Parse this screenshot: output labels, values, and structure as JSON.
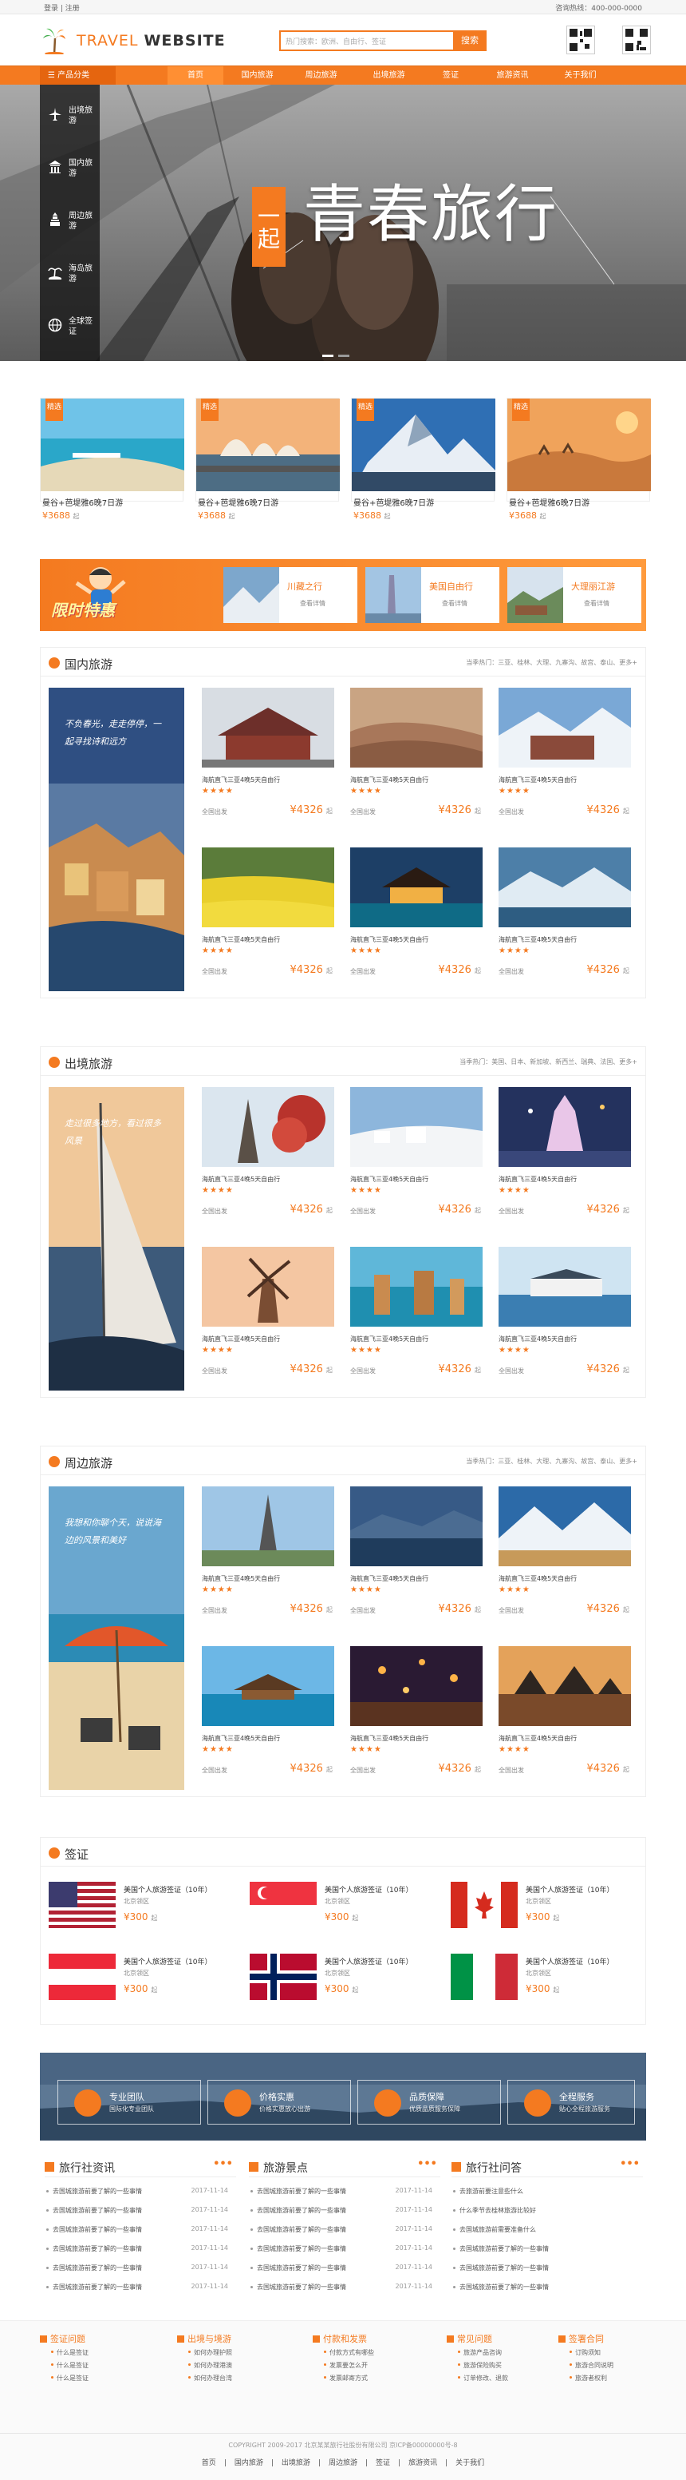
{
  "topbar": {
    "left": "登录 | 注册",
    "right": "咨询热线：400-000-0000"
  },
  "header": {
    "logo_light": "TRAVEL",
    "logo_bold": "WEBSITE",
    "search_placeholder": "热门搜索：欧洲、自由行、签证",
    "search_button": "搜索"
  },
  "nav": {
    "category": "产品分类",
    "items": [
      "首页",
      "国内旅游",
      "周边旅游",
      "出境旅游",
      "签证",
      "旅游资讯",
      "关于我们"
    ]
  },
  "banner": {
    "side": [
      {
        "label": "出境旅游",
        "icon": "plane-icon"
      },
      {
        "label": "国内旅游",
        "icon": "temple-icon"
      },
      {
        "label": "周边旅游",
        "icon": "tower-icon"
      },
      {
        "label": "海岛旅游",
        "icon": "island-icon"
      },
      {
        "label": "全球签证",
        "icon": "visa-icon"
      }
    ],
    "slogan_small": "一起",
    "slogan_big": "青春旅行"
  },
  "promos": [
    {
      "tag": "精选",
      "title": "曼谷+芭堤雅6晚7日游",
      "price": "¥3688",
      "unit": "起"
    },
    {
      "tag": "精选",
      "title": "曼谷+芭堤雅6晚7日游",
      "price": "¥3688",
      "unit": "起"
    },
    {
      "tag": "精选",
      "title": "曼谷+芭堤雅6晚7日游",
      "price": "¥3688",
      "unit": "起"
    },
    {
      "tag": "精选",
      "title": "曼谷+芭堤雅6晚7日游",
      "price": "¥3688",
      "unit": "起"
    }
  ],
  "specials": {
    "title": "限时特惠",
    "items": [
      {
        "title": "川藏之行",
        "link": "查看详情"
      },
      {
        "title": "美国自由行",
        "link": "查看详情"
      },
      {
        "title": "大理丽江游",
        "link": "查看详情"
      }
    ]
  },
  "sections": [
    {
      "title": "国内旅游",
      "hot": "当季热门：三亚、桂林、大理、九寨沟、故宫、泰山、更多+",
      "poster_text": "不负春光，走走停停，一起寻找诗和远方",
      "cards": [
        {
          "title": "海航直飞三亚4晚5天自由行",
          "stars": "★★★★",
          "sub": "全国出发",
          "price": "¥4326",
          "unit": "起"
        },
        {
          "title": "海航直飞三亚4晚5天自由行",
          "stars": "★★★★",
          "sub": "全国出发",
          "price": "¥4326",
          "unit": "起"
        },
        {
          "title": "海航直飞三亚4晚5天自由行",
          "stars": "★★★★",
          "sub": "全国出发",
          "price": "¥4326",
          "unit": "起"
        },
        {
          "title": "海航直飞三亚4晚5天自由行",
          "stars": "★★★★",
          "sub": "全国出发",
          "price": "¥4326",
          "unit": "起"
        },
        {
          "title": "海航直飞三亚4晚5天自由行",
          "stars": "★★★★",
          "sub": "全国出发",
          "price": "¥4326",
          "unit": "起"
        },
        {
          "title": "海航直飞三亚4晚5天自由行",
          "stars": "★★★★",
          "sub": "全国出发",
          "price": "¥4326",
          "unit": "起"
        }
      ]
    },
    {
      "title": "出境旅游",
      "hot": "当季热门：美国、日本、新加坡、新西兰、瑞典、法国、更多+",
      "poster_text": "走过很多地方，看过很多风景",
      "cards": [
        {
          "title": "海航直飞三亚4晚5天自由行",
          "stars": "★★★★",
          "sub": "全国出发",
          "price": "¥4326",
          "unit": "起"
        },
        {
          "title": "海航直飞三亚4晚5天自由行",
          "stars": "★★★★",
          "sub": "全国出发",
          "price": "¥4326",
          "unit": "起"
        },
        {
          "title": "海航直飞三亚4晚5天自由行",
          "stars": "★★★★",
          "sub": "全国出发",
          "price": "¥4326",
          "unit": "起"
        },
        {
          "title": "海航直飞三亚4晚5天自由行",
          "stars": "★★★★",
          "sub": "全国出发",
          "price": "¥4326",
          "unit": "起"
        },
        {
          "title": "海航直飞三亚4晚5天自由行",
          "stars": "★★★★",
          "sub": "全国出发",
          "price": "¥4326",
          "unit": "起"
        },
        {
          "title": "海航直飞三亚4晚5天自由行",
          "stars": "★★★★",
          "sub": "全国出发",
          "price": "¥4326",
          "unit": "起"
        }
      ]
    },
    {
      "title": "周边旅游",
      "hot": "当季热门：三亚、桂林、大理、九寨沟、故宫、泰山、更多+",
      "poster_text": "我想和你聊个天，说说海边的风景和美好",
      "cards": [
        {
          "title": "海航直飞三亚4晚5天自由行",
          "stars": "★★★★",
          "sub": "全国出发",
          "price": "¥4326",
          "unit": "起"
        },
        {
          "title": "海航直飞三亚4晚5天自由行",
          "stars": "★★★★",
          "sub": "全国出发",
          "price": "¥4326",
          "unit": "起"
        },
        {
          "title": "海航直飞三亚4晚5天自由行",
          "stars": "★★★★",
          "sub": "全国出发",
          "price": "¥4326",
          "unit": "起"
        },
        {
          "title": "海航直飞三亚4晚5天自由行",
          "stars": "★★★★",
          "sub": "全国出发",
          "price": "¥4326",
          "unit": "起"
        },
        {
          "title": "海航直飞三亚4晚5天自由行",
          "stars": "★★★★",
          "sub": "全国出发",
          "price": "¥4326",
          "unit": "起"
        },
        {
          "title": "海航直飞三亚4晚5天自由行",
          "stars": "★★★★",
          "sub": "全国出发",
          "price": "¥4326",
          "unit": "起"
        }
      ]
    }
  ],
  "visa": {
    "title": "签证",
    "items": [
      {
        "country": "usa",
        "title": "美国个人旅游签证（10年）",
        "sub": "北京领区",
        "price": "¥300",
        "unit": "起"
      },
      {
        "country": "singapore",
        "title": "美国个人旅游签证（10年）",
        "sub": "北京领区",
        "price": "¥300",
        "unit": "起"
      },
      {
        "country": "canada",
        "title": "美国个人旅游签证（10年）",
        "sub": "北京领区",
        "price": "¥300",
        "unit": "起"
      },
      {
        "country": "austria",
        "title": "美国个人旅游签证（10年）",
        "sub": "北京领区",
        "price": "¥300",
        "unit": "起"
      },
      {
        "country": "norway",
        "title": "美国个人旅游签证（10年）",
        "sub": "北京领区",
        "price": "¥300",
        "unit": "起"
      },
      {
        "country": "italy",
        "title": "美国个人旅游签证（10年）",
        "sub": "北京领区",
        "price": "¥300",
        "unit": "起"
      }
    ]
  },
  "features": [
    {
      "a": "专业团队",
      "b": "国际化专业团队",
      "icon": "location-icon"
    },
    {
      "a": "价格实惠",
      "b": "价格实惠放心出游",
      "icon": "yen-icon"
    },
    {
      "a": "品质保障",
      "b": "优质品质服务保障",
      "icon": "diamond-icon"
    },
    {
      "a": "全程服务",
      "b": "贴心全程旅游服务",
      "icon": "service-icon"
    }
  ],
  "news": [
    {
      "title": "旅行社资讯",
      "more": "•••",
      "rows": [
        {
          "t": "去国城旅游前要了解的一些事情",
          "d": "2017-11-14"
        },
        {
          "t": "去国城旅游前要了解的一些事情",
          "d": "2017-11-14"
        },
        {
          "t": "去国城旅游前要了解的一些事情",
          "d": "2017-11-14"
        },
        {
          "t": "去国城旅游前要了解的一些事情",
          "d": "2017-11-14"
        },
        {
          "t": "去国城旅游前要了解的一些事情",
          "d": "2017-11-14"
        },
        {
          "t": "去国城旅游前要了解的一些事情",
          "d": "2017-11-14"
        }
      ]
    },
    {
      "title": "旅游景点",
      "more": "•••",
      "rows": [
        {
          "t": "去国城旅游前要了解的一些事情",
          "d": "2017-11-14"
        },
        {
          "t": "去国城旅游前要了解的一些事情",
          "d": "2017-11-14"
        },
        {
          "t": "去国城旅游前要了解的一些事情",
          "d": "2017-11-14"
        },
        {
          "t": "去国城旅游前要了解的一些事情",
          "d": "2017-11-14"
        },
        {
          "t": "去国城旅游前要了解的一些事情",
          "d": "2017-11-14"
        },
        {
          "t": "去国城旅游前要了解的一些事情",
          "d": "2017-11-14"
        }
      ]
    },
    {
      "title": "旅行社问答",
      "more": "•••",
      "rows": [
        {
          "t": "去旅游前要注意些什么",
          "d": ""
        },
        {
          "t": "什么季节去桂林旅游比较好",
          "d": ""
        },
        {
          "t": "去国城旅游前需要准备什么",
          "d": ""
        },
        {
          "t": "去国城旅游前要了解的一些事情",
          "d": ""
        },
        {
          "t": "去国城旅游前要了解的一些事情",
          "d": ""
        },
        {
          "t": "去国城旅游前要了解的一些事情",
          "d": ""
        }
      ]
    }
  ],
  "footer": {
    "cols": [
      {
        "title": "签证问题",
        "links": [
          "什么是签证",
          "什么是签证",
          "什么是签证"
        ]
      },
      {
        "title": "出境与境游",
        "links": [
          "如何办理护照",
          "如何办理港澳",
          "如何办理台湾"
        ]
      },
      {
        "title": "付款和发票",
        "links": [
          "付款方式有哪些",
          "发票要怎么开",
          "发票邮寄方式"
        ]
      },
      {
        "title": "常见问题",
        "links": [
          "旅游产品咨询",
          "旅游保险购买",
          "订单修改、退款"
        ]
      },
      {
        "title": "签署合同",
        "links": [
          "订购须知",
          "旅游合同说明",
          "旅游者权利"
        ]
      }
    ],
    "copyright": "COPYRIGHT 2009-2017 北京某某旅行社股份有限公司 京ICP备00000000号-8",
    "links": [
      "首页",
      "国内旅游",
      "出境旅游",
      "周边旅游",
      "签证",
      "旅游资讯",
      "关于我们"
    ]
  }
}
